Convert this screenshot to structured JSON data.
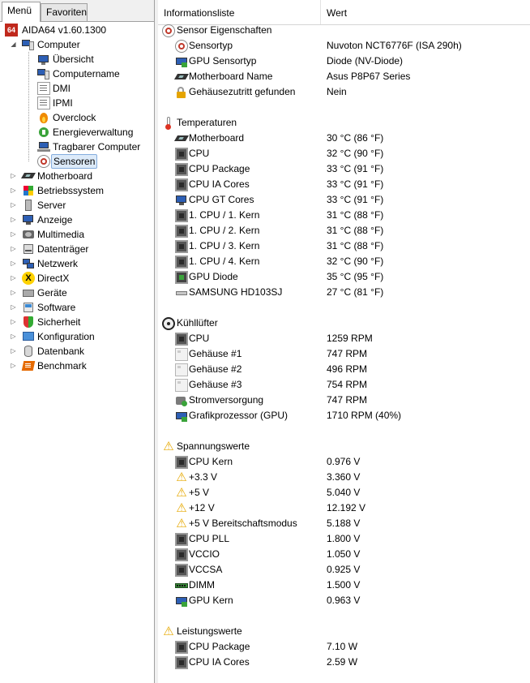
{
  "tabs": {
    "menu": "Menü",
    "favorites": "Favoriten"
  },
  "tree": {
    "root": "AIDA64 v1.60.1300",
    "computer": "Computer",
    "computer_children": [
      "Übersicht",
      "Computername",
      "DMI",
      "IPMI",
      "Overclock",
      "Energieverwaltung",
      "Tragbarer Computer",
      "Sensoren"
    ],
    "selected": "Sensoren",
    "top_items": [
      "Motherboard",
      "Betriebssystem",
      "Server",
      "Anzeige",
      "Multimedia",
      "Datenträger",
      "Netzwerk",
      "DirectX",
      "Geräte",
      "Software",
      "Sicherheit",
      "Konfiguration",
      "Datenbank",
      "Benchmark"
    ]
  },
  "list": {
    "col_info": "Informationsliste",
    "col_value": "Wert",
    "sections": [
      {
        "title": "Sensor Eigenschaften",
        "icon": "sensor-icon",
        "rows": [
          {
            "name": "Sensortyp",
            "value": "Nuvoton NCT6776F  (ISA 290h)",
            "icon": "sensor-icon"
          },
          {
            "name": "GPU Sensortyp",
            "value": "Diode  (NV-Diode)",
            "icon": "gpu-icon"
          },
          {
            "name": "Motherboard Name",
            "value": "Asus P8P67 Series",
            "icon": "motherboard-icon"
          },
          {
            "name": "Gehäusezutritt gefunden",
            "value": "Nein",
            "icon": "lock-icon"
          }
        ]
      },
      {
        "title": "Temperaturen",
        "icon": "thermometer-icon",
        "rows": [
          {
            "name": "Motherboard",
            "value": "30 °C  (86 °F)",
            "icon": "motherboard-icon"
          },
          {
            "name": "CPU",
            "value": "32 °C  (90 °F)",
            "icon": "chip-icon"
          },
          {
            "name": "CPU Package",
            "value": "33 °C  (91 °F)",
            "icon": "chip-icon"
          },
          {
            "name": "CPU IA Cores",
            "value": "33 °C  (91 °F)",
            "icon": "chip-icon"
          },
          {
            "name": "CPU GT Cores",
            "value": "33 °C  (91 °F)",
            "icon": "monitor-icon"
          },
          {
            "name": "1. CPU / 1. Kern",
            "value": "31 °C  (88 °F)",
            "icon": "chip-icon"
          },
          {
            "name": "1. CPU / 2. Kern",
            "value": "31 °C  (88 °F)",
            "icon": "chip-icon"
          },
          {
            "name": "1. CPU / 3. Kern",
            "value": "31 °C  (88 °F)",
            "icon": "chip-icon"
          },
          {
            "name": "1. CPU / 4. Kern",
            "value": "32 °C  (90 °F)",
            "icon": "chip-icon"
          },
          {
            "name": "GPU Diode",
            "value": "35 °C  (95 °F)",
            "icon": "gpu-chip-icon"
          },
          {
            "name": "SAMSUNG HD103SJ",
            "value": "27 °C  (81 °F)",
            "icon": "hdd-icon"
          }
        ]
      },
      {
        "title": "Kühllüfter",
        "icon": "fan-icon",
        "rows": [
          {
            "name": "CPU",
            "value": "1259 RPM",
            "icon": "chip-icon"
          },
          {
            "name": "Gehäuse #1",
            "value": "747 RPM",
            "icon": "case-icon"
          },
          {
            "name": "Gehäuse #2",
            "value": "496 RPM",
            "icon": "case-icon"
          },
          {
            "name": "Gehäuse #3",
            "value": "754 RPM",
            "icon": "case-icon"
          },
          {
            "name": "Stromversorgung",
            "value": "747 RPM",
            "icon": "psu-icon"
          },
          {
            "name": "Grafikprozessor (GPU)",
            "value": "1710 RPM  (40%)",
            "icon": "gpu-icon"
          }
        ]
      },
      {
        "title": "Spannungswerte",
        "icon": "warning-icon",
        "rows": [
          {
            "name": "CPU Kern",
            "value": "0.976 V",
            "icon": "chip-icon"
          },
          {
            "name": "+3.3 V",
            "value": "3.360 V",
            "icon": "warning-icon"
          },
          {
            "name": "+5 V",
            "value": "5.040 V",
            "icon": "warning-icon"
          },
          {
            "name": "+12 V",
            "value": "12.192 V",
            "icon": "warning-icon"
          },
          {
            "name": "+5 V Bereitschaftsmodus",
            "value": "5.188 V",
            "icon": "warning-icon"
          },
          {
            "name": "CPU PLL",
            "value": "1.800 V",
            "icon": "chip-icon"
          },
          {
            "name": "VCCIO",
            "value": "1.050 V",
            "icon": "chip-icon"
          },
          {
            "name": "VCCSA",
            "value": "0.925 V",
            "icon": "chip-icon"
          },
          {
            "name": "DIMM",
            "value": "1.500 V",
            "icon": "ram-icon"
          },
          {
            "name": "GPU Kern",
            "value": "0.963 V",
            "icon": "gpu-icon"
          }
        ]
      },
      {
        "title": "Leistungswerte",
        "icon": "warning-icon",
        "rows": [
          {
            "name": "CPU Package",
            "value": "7.10 W",
            "icon": "chip-icon"
          },
          {
            "name": "CPU IA Cores",
            "value": "2.59 W",
            "icon": "chip-icon"
          }
        ]
      }
    ]
  }
}
